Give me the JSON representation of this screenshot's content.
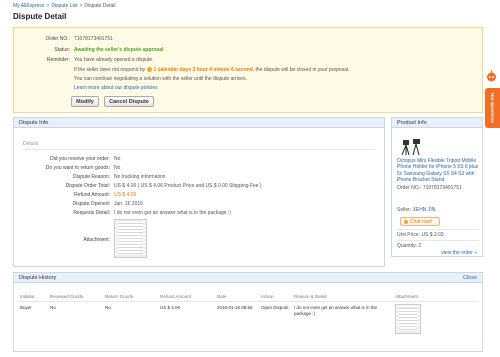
{
  "breadcrumb": {
    "items": [
      "My AliExpress",
      "Dispute List",
      "Dispute Detail"
    ],
    "separator": ">"
  },
  "page_title": "Dispute Detail",
  "summary": {
    "order_no_label": "Order NO.:",
    "order_no_value": "71078173491751",
    "status_label": "Status:",
    "status_value": "Awaiting the seller's dispute approval",
    "reminder_label": "Reminder:",
    "reminder_line1": "You have already opened a dispute.",
    "reminder_line2_pre": "If the seller does not respond by",
    "reminder_countdown": "1 calendar days 3 hour 4 minute 6 second",
    "reminder_line2_post": ", the dispute will be closed in your proposal.",
    "reminder_line3": "You can continue negotiating a solution with the seller until the dispute arrives.",
    "learn_more": "Learn more about our dispute policies",
    "modify_button": "Modify",
    "cancel_button": "Cancel Dispute"
  },
  "dispute_info": {
    "title": "Dispute Info",
    "details_label": "Details",
    "rows": [
      {
        "label": "Did you receive your order:",
        "value": "No"
      },
      {
        "label": "Do you want to return goods:",
        "value": "No"
      },
      {
        "label": "Dispute Reason:",
        "value": "No tracking information"
      },
      {
        "label": "Dispute Order Total:",
        "value": "US $ 4.06 ( US $ 4.06 Product Price and US $ 0.00 Shipping Fee )"
      },
      {
        "label": "Refund Amount:",
        "value": "US $ 4.06"
      },
      {
        "label": "Dispute Opened:",
        "value": "Jan. 16 2016"
      },
      {
        "label": "Requests Detail:",
        "value": "I do not even get an answer what is in the package :)"
      }
    ],
    "attachment_label": "Attachment:"
  },
  "product_info": {
    "title": "Product Info",
    "name": "Octopus Mini Flexible Tripod Mobile Phone Holder for iPhone 5 5S 6 plus 5c Samsung Galaxy S5 S4 S3 with Phone Bracket Stand",
    "order_no": "Order NO.: 71078173491751",
    "seller_label": "Seller:",
    "seller_name": "XEHN JIN",
    "chat_now": "Chat now!",
    "unit_price": "Unit Price: US $ 2.03",
    "quantity": "Quantity: 2",
    "view_order": "view the order »"
  },
  "dispute_history": {
    "title": "Dispute History",
    "close": "Close",
    "columns": [
      "Initiator",
      "Received Goods",
      "Return Goods",
      "Refund Amount",
      "Date",
      "Action",
      "Reason & Detail",
      "Attachment"
    ],
    "rows": [
      [
        "Buyer",
        "No",
        "No",
        "US $ 4.06",
        "2016-01-16 08:56",
        "Open Dispute",
        "I do not even get an answer what is in the",
        "package :)"
      ]
    ]
  },
  "side_tab": {
    "label": "Hot questions"
  },
  "colors": {
    "accent_orange": "#f07b00",
    "status_green": "#4aa61b",
    "link_blue": "#2a65b3",
    "side_tab": "#f36d24"
  }
}
